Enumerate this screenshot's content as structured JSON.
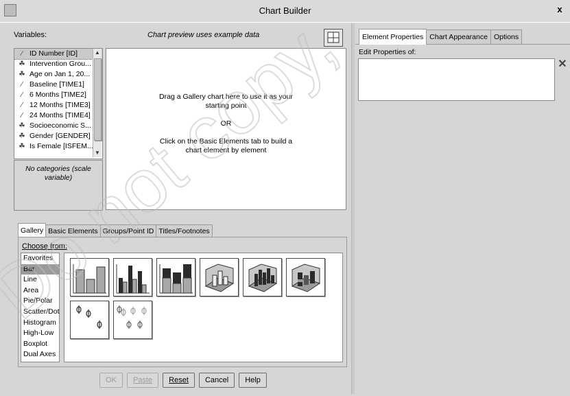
{
  "window": {
    "title": "Chart Builder",
    "close_glyph": "x"
  },
  "left_panel": {
    "variables_label": "Variables:",
    "preview_note": "Chart preview uses example data",
    "variables": [
      {
        "name": "ID Number [ID]",
        "icon": "scale-ruler-icon",
        "selected": true
      },
      {
        "name": "Intervention Grou...",
        "icon": "nominal-group-icon"
      },
      {
        "name": "Age on Jan 1, 20...",
        "icon": "nominal-group-icon"
      },
      {
        "name": "Baseline [TIME1]",
        "icon": "scale-ruler-icon"
      },
      {
        "name": "6 Months [TIME2]",
        "icon": "scale-ruler-icon"
      },
      {
        "name": "12 Months [TIME3]",
        "icon": "scale-ruler-icon"
      },
      {
        "name": "24 Months [TIME4]",
        "icon": "scale-ruler-icon"
      },
      {
        "name": "Socioeconomic S...",
        "icon": "nominal-group-icon"
      },
      {
        "name": "Gender [GENDER]",
        "icon": "nominal-group-icon"
      },
      {
        "name": "Is Female [ISFEM...",
        "icon": "nominal-group-icon"
      }
    ],
    "categories_note": "No categories (scale variable)",
    "canvas": {
      "line1": "Drag a Gallery chart here to use it as your",
      "line2": "starting point",
      "or": "OR",
      "line3": "Click on the Basic Elements tab to build a",
      "line4": "chart element by element"
    }
  },
  "tabs": [
    {
      "label": "Gallery",
      "active": true
    },
    {
      "label": "Basic Elements"
    },
    {
      "label": "Groups/Point ID"
    },
    {
      "label": "Titles/Footnotes"
    }
  ],
  "gallery": {
    "choose_from_label": "Choose from:",
    "chart_types": [
      "Favorites",
      "Bar",
      "Line",
      "Area",
      "Pie/Polar",
      "Scatter/Dot",
      "Histogram",
      "High-Low",
      "Boxplot",
      "Dual Axes"
    ],
    "selected_type": "Bar"
  },
  "buttons": {
    "ok": "OK",
    "paste": "Paste",
    "reset": "Reset",
    "cancel": "Cancel",
    "help": "Help"
  },
  "right_panel": {
    "tabs": [
      {
        "label": "Element Properties",
        "active": true
      },
      {
        "label": "Chart Appearance"
      },
      {
        "label": "Options"
      }
    ],
    "edit_properties_label": "Edit Properties of:",
    "delete_glyph": "✕"
  },
  "colors": {
    "window_bg": "#d6d6d6",
    "selection": "#9b9b9b",
    "bar_light": "#a8a8a8",
    "bar_dark": "#2b2b2b"
  }
}
